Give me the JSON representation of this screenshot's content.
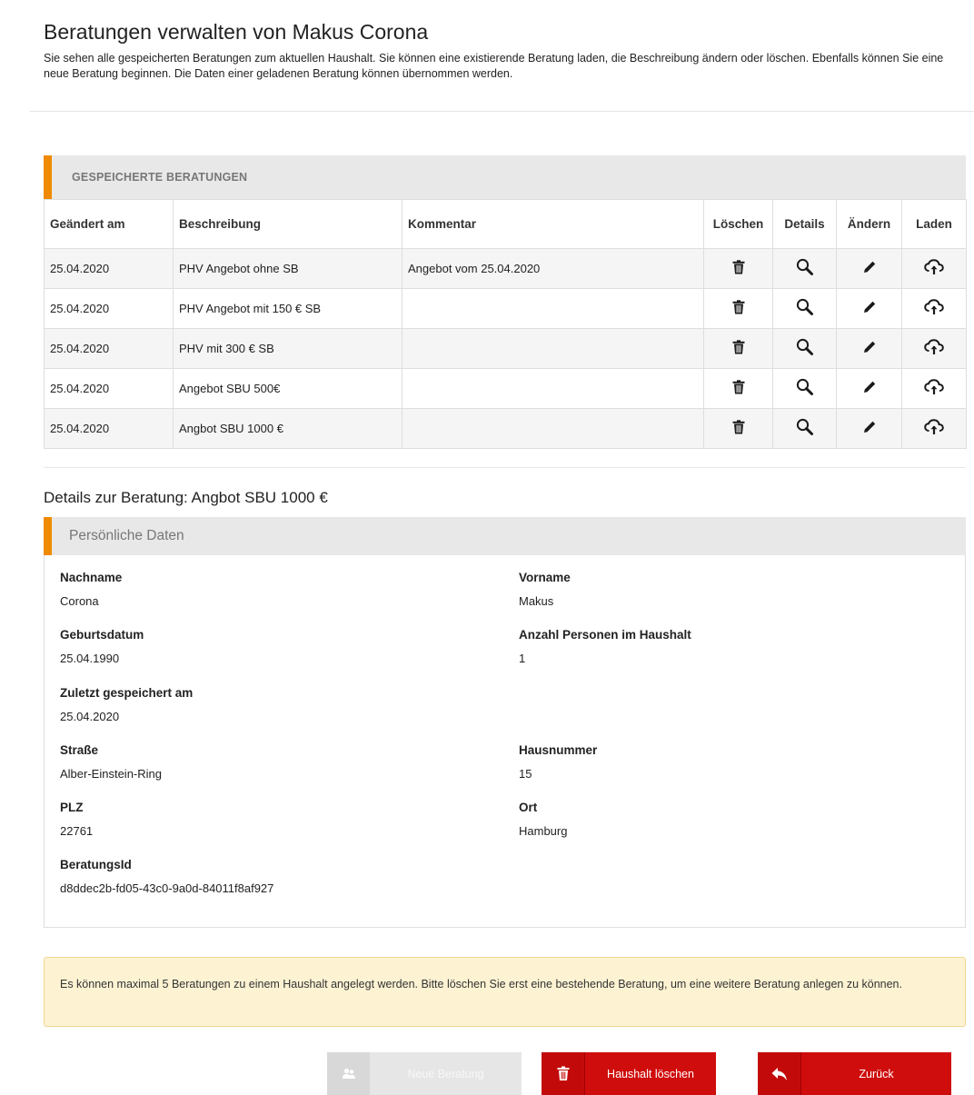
{
  "page": {
    "title": "Beratungen verwalten von Makus Corona",
    "intro": "Sie sehen alle gespeicherten Beratungen zum aktuellen Haushalt. Sie können eine existierende Beratung laden, die Beschreibung ändern oder löschen. Ebenfalls können Sie eine neue Beratung beginnen. Die Daten einer geladenen Beratung können übernommen werden."
  },
  "saved": {
    "heading": "GESPEICHERTE BERATUNGEN",
    "columns": {
      "date": "Geändert am",
      "desc": "Beschreibung",
      "comment": "Kommentar",
      "delete": "Löschen",
      "details": "Details",
      "edit": "Ändern",
      "load": "Laden"
    },
    "rows": [
      {
        "date": "25.04.2020",
        "desc": "PHV Angebot ohne SB",
        "comment": "Angebot vom 25.04.2020"
      },
      {
        "date": "25.04.2020",
        "desc": "PHV Angebot mit 150 € SB",
        "comment": ""
      },
      {
        "date": "25.04.2020",
        "desc": "PHV mit 300 € SB",
        "comment": ""
      },
      {
        "date": "25.04.2020",
        "desc": "Angebot SBU 500€",
        "comment": ""
      },
      {
        "date": "25.04.2020",
        "desc": "Angbot SBU 1000 €",
        "comment": ""
      }
    ]
  },
  "details": {
    "title": "Details zur Beratung: Angbot SBU 1000 €",
    "panel_heading": "Persönliche Daten",
    "fields": {
      "nachname": {
        "label": "Nachname",
        "value": "Corona"
      },
      "vorname": {
        "label": "Vorname",
        "value": "Makus"
      },
      "geburtsdatum": {
        "label": "Geburtsdatum",
        "value": "25.04.1990"
      },
      "anzahl": {
        "label": "Anzahl Personen im Haushalt",
        "value": "1"
      },
      "zuletzt": {
        "label": "Zuletzt gespeichert am",
        "value": "25.04.2020"
      },
      "strasse": {
        "label": "Straße",
        "value": "Alber-Einstein-Ring"
      },
      "hausnummer": {
        "label": "Hausnummer",
        "value": "15"
      },
      "plz": {
        "label": "PLZ",
        "value": "22761"
      },
      "ort": {
        "label": "Ort",
        "value": "Hamburg"
      },
      "beratungsid": {
        "label": "BeratungsId",
        "value": "d8ddec2b-fd05-43c0-9a0d-84011f8af927"
      }
    }
  },
  "alert": {
    "text": "Es können maximal 5 Beratungen zu einem Haushalt angelegt werden. Bitte löschen Sie erst eine bestehende Beratung, um eine weitere Beratung anlegen zu können."
  },
  "buttons": {
    "new_label": "Neue Beratung",
    "new_icon": "users-icon",
    "delete_household_label": "Haushalt löschen",
    "delete_household_icon": "trash-icon",
    "back_label": "Zurück",
    "back_icon": "reply-arrow-icon"
  },
  "colors": {
    "accent": "#f08a00",
    "danger": "#cf0d0d",
    "alert_bg": "#fdf3d3"
  }
}
